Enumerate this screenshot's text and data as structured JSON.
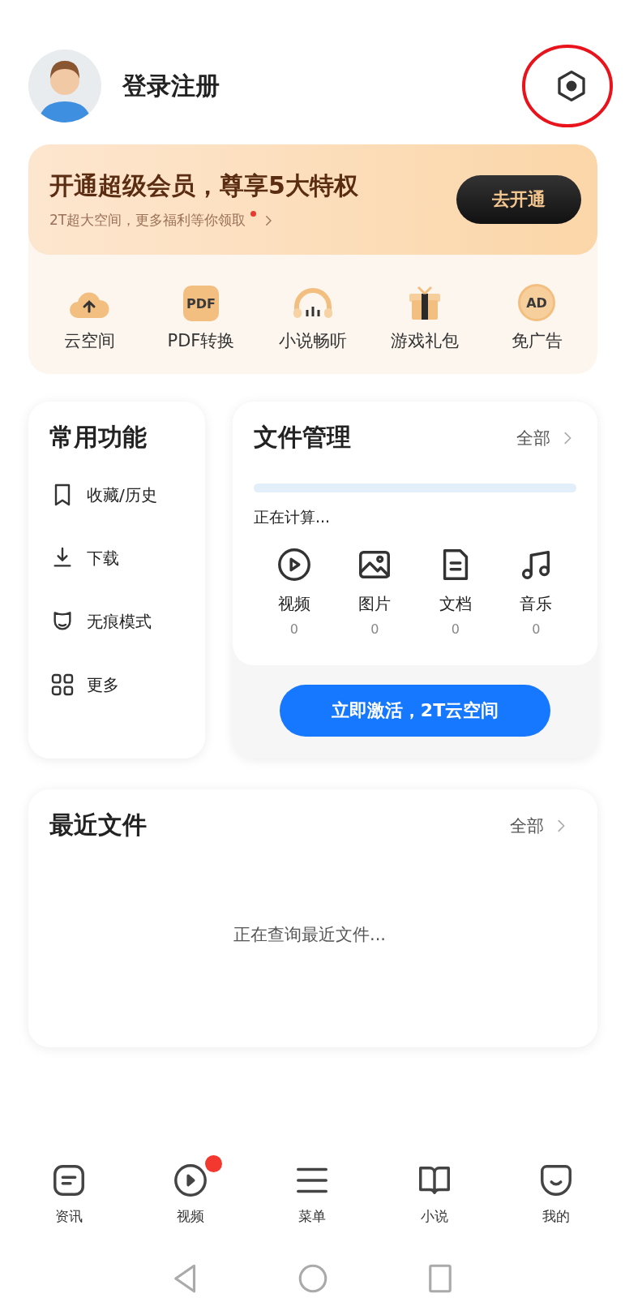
{
  "header": {
    "title": "登录注册"
  },
  "vip": {
    "title": "开通超级会员，尊享5大特权",
    "subtitle": "2T超大空间，更多福利等你领取",
    "dot": true,
    "button": "去开通",
    "perks": [
      {
        "kind": "cloud",
        "label": "云空间"
      },
      {
        "kind": "pdf",
        "label": "PDF转换",
        "glyph": "PDF"
      },
      {
        "kind": "headphones",
        "label": "小说畅听"
      },
      {
        "kind": "gift",
        "label": "游戏礼包"
      },
      {
        "kind": "noad",
        "label": "免广告",
        "glyph": "AD"
      }
    ]
  },
  "common": {
    "title": "常用功能",
    "items": [
      {
        "kind": "bookmark",
        "label": "收藏/历史"
      },
      {
        "kind": "download",
        "label": "下载"
      },
      {
        "kind": "incognito",
        "label": "无痕模式"
      },
      {
        "kind": "grid",
        "label": "更多"
      }
    ]
  },
  "files": {
    "title": "文件管理",
    "all": "全部",
    "status": "正在计算...",
    "types": [
      {
        "kind": "video",
        "label": "视频",
        "count": "0"
      },
      {
        "kind": "image",
        "label": "图片",
        "count": "0"
      },
      {
        "kind": "doc",
        "label": "文档",
        "count": "0"
      },
      {
        "kind": "music",
        "label": "音乐",
        "count": "0"
      }
    ],
    "button": "立即激活，2T云空间"
  },
  "recent": {
    "title": "最近文件",
    "all": "全部",
    "message": "正在查询最近文件..."
  },
  "nav": [
    {
      "kind": "news",
      "label": "资讯",
      "dot": false
    },
    {
      "kind": "video",
      "label": "视频",
      "dot": true
    },
    {
      "kind": "menu",
      "label": "菜单",
      "dot": false
    },
    {
      "kind": "book",
      "label": "小说",
      "dot": false
    },
    {
      "kind": "smile",
      "label": "我的",
      "dot": false
    }
  ]
}
